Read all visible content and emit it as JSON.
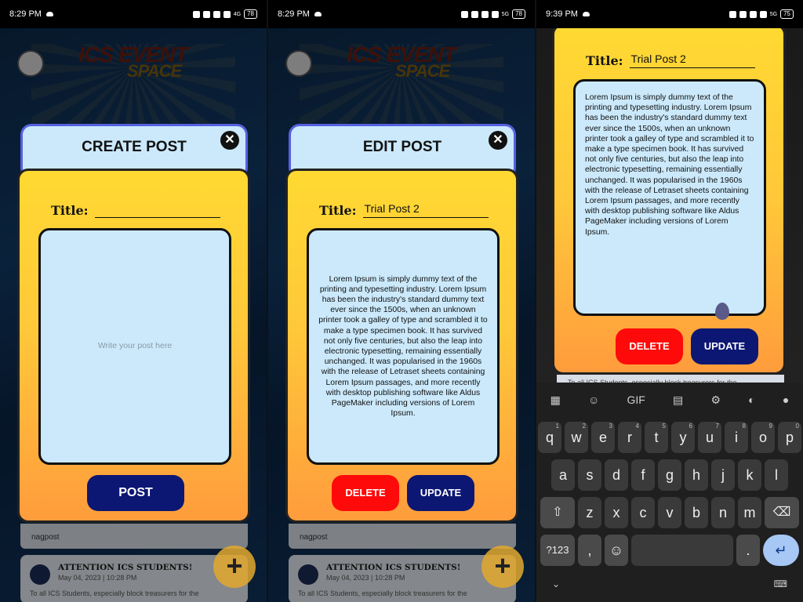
{
  "status_bars": [
    {
      "time": "8:29 PM",
      "battery": "78",
      "net": "4G"
    },
    {
      "time": "8:29 PM",
      "battery": "78",
      "net": "5G"
    },
    {
      "time": "9:39 PM",
      "battery": "75",
      "net": "5G"
    }
  ],
  "logo": {
    "line1": "ICS EVENT",
    "line2": "SPACE"
  },
  "create": {
    "header": "CREATE POST",
    "title_label": "Title:",
    "title_value": "",
    "body_placeholder": "Write your post here",
    "post_button": "POST"
  },
  "edit": {
    "header": "EDIT POST",
    "title_label": "Title:",
    "title_value": "Trial Post 2",
    "body": "Lorem Ipsum is simply dummy text of the printing and typesetting industry. Lorem Ipsum has been the industry's standard dummy text ever since the 1500s, when an unknown printer took a galley of type and scrambled it to make a type specimen book. It has survived not only five centuries, but also the leap into electronic typesetting, remaining essentially unchanged. It was popularised in the 1960s with the release of Letraset sheets containing Lorem Ipsum passages, and more recently with desktop publishing software like Aldus PageMaker including versions of Lorem Ipsum.",
    "delete_button": "DELETE",
    "update_button": "UPDATE"
  },
  "feed": {
    "prev_author": "nagpost",
    "post_title": "ATTENTION ICS STUDENTS!",
    "post_date": "May 04, 2023 | 10:28 PM",
    "post_snippet": "To all ICS Students, especially block treasurers for the"
  },
  "fab_label": "+",
  "keyboard": {
    "toolbar": [
      "grid-icon",
      "sticker-icon",
      "GIF",
      "clipboard-icon",
      "gear-icon",
      "palette-icon",
      "mic-icon"
    ],
    "row1": [
      [
        "q",
        "1"
      ],
      [
        "w",
        "2"
      ],
      [
        "e",
        "3"
      ],
      [
        "r",
        "4"
      ],
      [
        "t",
        "5"
      ],
      [
        "y",
        "6"
      ],
      [
        "u",
        "7"
      ],
      [
        "i",
        "8"
      ],
      [
        "o",
        "9"
      ],
      [
        "p",
        "0"
      ]
    ],
    "row2": [
      "a",
      "s",
      "d",
      "f",
      "g",
      "h",
      "j",
      "k",
      "l"
    ],
    "row3": [
      "z",
      "x",
      "c",
      "v",
      "b",
      "n",
      "m"
    ],
    "sym_label": "?123",
    "comma": ",",
    "period": "."
  }
}
